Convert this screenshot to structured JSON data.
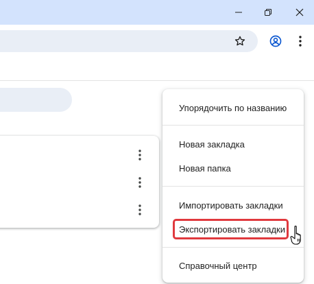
{
  "window": {
    "controls": {
      "minimize_icon": "minimize-icon",
      "maximize_icon": "restore-icon",
      "close_icon": "close-icon"
    },
    "titlebar_color": "#d3e3fd"
  },
  "toolbar": {
    "address_value": "",
    "star_icon": "star-outline-icon",
    "profile_icon": "profile-icon",
    "menu_icon": "three-dots-vertical-icon"
  },
  "bookmarks_page": {
    "search_value": "",
    "rows": [
      {
        "menu_icon": "three-dots-vertical-icon"
      },
      {
        "menu_icon": "three-dots-vertical-icon"
      },
      {
        "menu_icon": "three-dots-vertical-icon"
      }
    ]
  },
  "dropdown_menu": {
    "sort_by_name": "Упорядочить по названию",
    "new_bookmark": "Новая закладка",
    "new_folder": "Новая папка",
    "import_bookmarks": "Импортировать закладки",
    "export_bookmarks": "Экспортировать закладки",
    "help_center": "Справочный центр"
  },
  "annotation": {
    "highlight_color": "#e0393e",
    "cursor_icon": "hand-pointer-icon"
  }
}
